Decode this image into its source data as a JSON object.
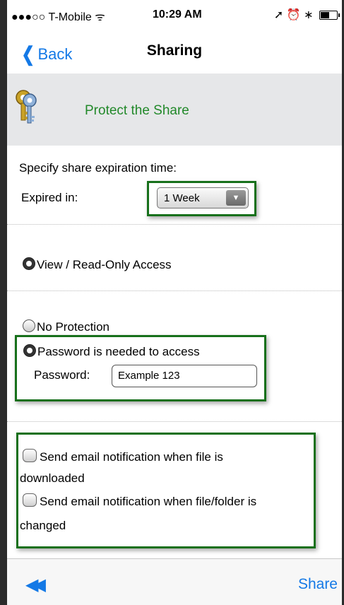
{
  "status_bar": {
    "carrier": "●●●○○ T-Mobile ᯤ",
    "time": "10:29 AM",
    "icons": "➚ ⏰ ∗"
  },
  "nav": {
    "back_label": "Back",
    "title": "Sharing"
  },
  "header": {
    "icon": "keys-icon",
    "label": "Protect the Share"
  },
  "expiration": {
    "heading": "Specify share expiration time:",
    "label": "Expired in:",
    "selected": "1 Week"
  },
  "access": {
    "view_only": "View / Read-Only Access",
    "no_protection": "No Protection",
    "password_needed": "Password is needed to access",
    "password_label": "Password:",
    "password_value": "Example 123"
  },
  "notifications": {
    "downloaded_line1": "Send email notification when file is",
    "downloaded_line2": "downloaded",
    "changed_line1": "Send email notification when file/folder is",
    "changed_line2": "changed"
  },
  "toolbar": {
    "rewind_icon": "rewind-icon",
    "share_label": "Share"
  },
  "colors": {
    "accent": "#1479e6",
    "green_text": "#22892a",
    "highlight_box": "#17701b",
    "band_bg": "#e6e7e9"
  }
}
